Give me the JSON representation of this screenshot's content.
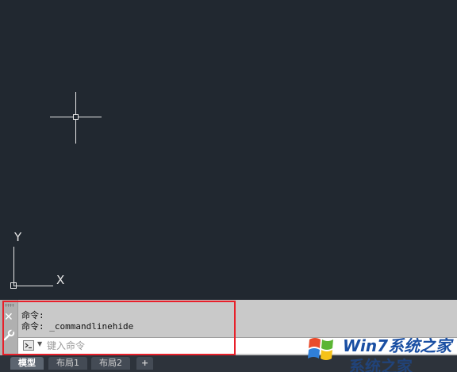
{
  "canvas": {
    "ucs": {
      "y_label": "Y",
      "x_label": "X"
    }
  },
  "command": {
    "history": [
      "命令:",
      "命令: _commandlinehide"
    ],
    "input": {
      "value": "",
      "placeholder": "键入命令"
    },
    "icons": {
      "close": "close-icon",
      "customize": "wrench-icon",
      "prompt": "command-prompt-icon"
    }
  },
  "tabs": [
    {
      "label": "模型",
      "active": true
    },
    {
      "label": "布局1",
      "active": false
    },
    {
      "label": "布局2",
      "active": false
    },
    {
      "label": "+",
      "active": false
    }
  ],
  "watermark": {
    "line1": "Win7系统之家",
    "line2": "系统之家"
  },
  "colors": {
    "canvas_bg": "#212830",
    "highlight": "#e8202a",
    "cursor": "#e6e6e6"
  }
}
